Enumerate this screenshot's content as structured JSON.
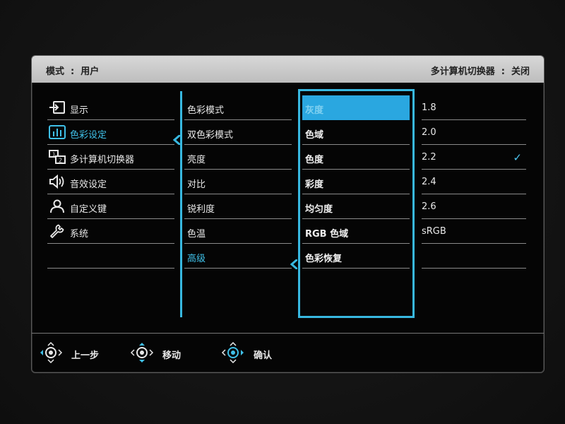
{
  "header": {
    "mode_label": "模式",
    "mode_value": "用户",
    "kvm_label": "多计算机切换器",
    "kvm_value": "关闭",
    "colon": ":"
  },
  "menu_main": [
    {
      "label": "显示",
      "icon": "input-icon"
    },
    {
      "label": "色彩设定",
      "icon": "bar-chart-icon",
      "active": true
    },
    {
      "label": "多计算机切换器",
      "icon": "kvm-switch-icon"
    },
    {
      "label": "音效设定",
      "icon": "speaker-icon"
    },
    {
      "label": "自定义键",
      "icon": "user-icon"
    },
    {
      "label": "系统",
      "icon": "wrench-icon"
    }
  ],
  "menu_color": [
    {
      "label": "色彩模式"
    },
    {
      "label": "双色彩模式"
    },
    {
      "label": "亮度"
    },
    {
      "label": "对比"
    },
    {
      "label": "锐利度"
    },
    {
      "label": "色温"
    },
    {
      "label": "高级",
      "active": true
    }
  ],
  "menu_advanced": [
    {
      "label": "灰度",
      "selected": true
    },
    {
      "label": "色域"
    },
    {
      "label": "色度"
    },
    {
      "label": "彩度"
    },
    {
      "label": "均匀度"
    },
    {
      "label": "RGB 色域"
    },
    {
      "label": "色彩恢复"
    }
  ],
  "menu_values": [
    {
      "label": "1.8"
    },
    {
      "label": "2.0"
    },
    {
      "label": "2.2",
      "checked": true
    },
    {
      "label": "2.4"
    },
    {
      "label": "2.6"
    },
    {
      "label": "sRGB"
    }
  ],
  "check_mark": "✓",
  "footer": [
    {
      "label": "上一步",
      "icon": "dpad-left-icon"
    },
    {
      "label": "移动",
      "icon": "dpad-updown-icon"
    },
    {
      "label": "确认",
      "icon": "dpad-press-icon"
    }
  ],
  "colors": {
    "accent": "#38b8e0",
    "selected_bg": "#2aa7e0",
    "header_bg": "#c8c8c8",
    "panel_bg": "#050505"
  }
}
